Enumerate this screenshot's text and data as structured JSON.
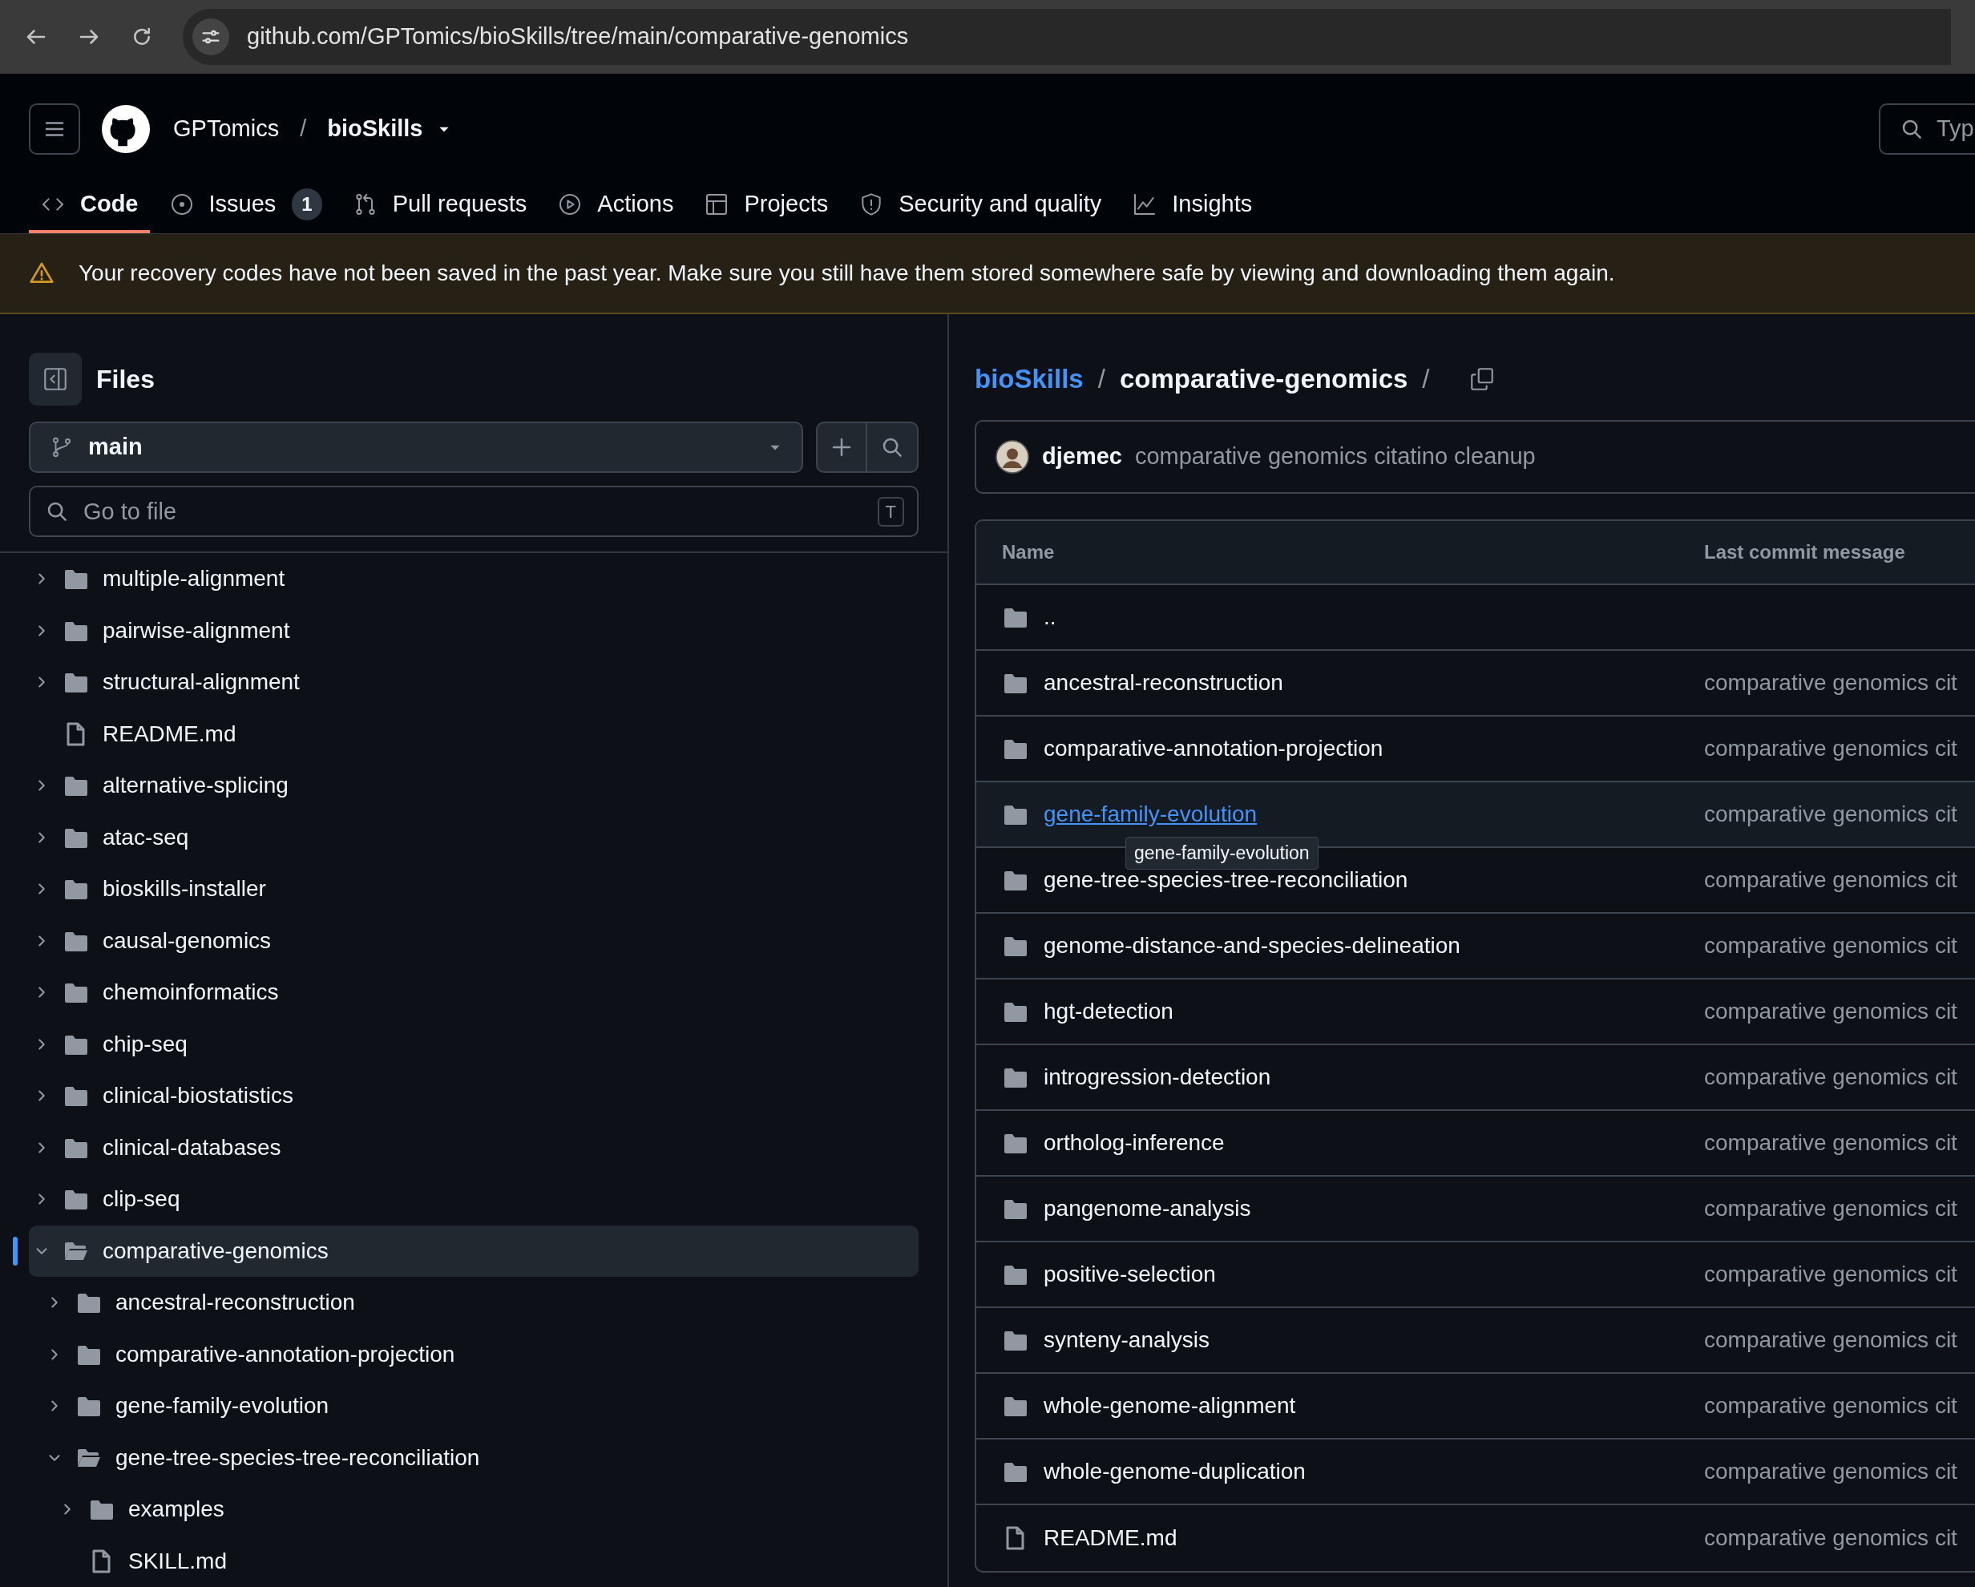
{
  "browser": {
    "url": "github.com/GPTomics/bioSkills/tree/main/comparative-genomics"
  },
  "header": {
    "owner": "GPTomics",
    "separator": "/",
    "repo": "bioSkills",
    "search_placeholder": "Typ"
  },
  "tabs": [
    {
      "kind": "code",
      "label": "Code",
      "selected": true
    },
    {
      "kind": "issues",
      "label": "Issues",
      "counter": "1",
      "selected": false
    },
    {
      "kind": "pulls",
      "label": "Pull requests",
      "selected": false
    },
    {
      "kind": "actions",
      "label": "Actions",
      "selected": false
    },
    {
      "kind": "projects",
      "label": "Projects",
      "selected": false
    },
    {
      "kind": "security",
      "label": "Security and quality",
      "selected": false
    },
    {
      "kind": "insights",
      "label": "Insights",
      "selected": false
    }
  ],
  "banner": {
    "message": "Your recovery codes have not been saved in the past year. Make sure you still have them stored somewhere safe by viewing and downloading them again."
  },
  "sidebar": {
    "title": "Files",
    "branch": "main",
    "search_placeholder": "Go to file",
    "shortcut": "T",
    "tree": [
      {
        "children": [
          {
            "name": "multiple-alignment",
            "kind": "folder",
            "expanded": false,
            "selected": false
          },
          {
            "name": "pairwise-alignment",
            "kind": "folder",
            "expanded": false,
            "selected": false
          },
          {
            "name": "structural-alignment",
            "kind": "folder",
            "expanded": false,
            "selected": false
          },
          {
            "name": "README.md",
            "kind": "file",
            "selected": false
          }
        ]
      },
      {
        "name": "alternative-splicing",
        "kind": "folder",
        "expanded": false,
        "selected": false
      },
      {
        "name": "atac-seq",
        "kind": "folder",
        "expanded": false,
        "selected": false
      },
      {
        "name": "bioskills-installer",
        "kind": "folder",
        "expanded": false,
        "selected": false
      },
      {
        "name": "causal-genomics",
        "kind": "folder",
        "expanded": false,
        "selected": false
      },
      {
        "name": "chemoinformatics",
        "kind": "folder",
        "expanded": false,
        "selected": false
      },
      {
        "name": "chip-seq",
        "kind": "folder",
        "expanded": false,
        "selected": false
      },
      {
        "name": "clinical-biostatistics",
        "kind": "folder",
        "expanded": false,
        "selected": false
      },
      {
        "name": "clinical-databases",
        "kind": "folder",
        "expanded": false,
        "selected": false
      },
      {
        "name": "clip-seq",
        "kind": "folder",
        "expanded": false,
        "selected": false
      },
      {
        "name": "comparative-genomics",
        "kind": "folder",
        "expanded": true,
        "selected": true,
        "children": [
          {
            "name": "ancestral-reconstruction",
            "kind": "folder",
            "expanded": false,
            "selected": false
          },
          {
            "name": "comparative-annotation-projection",
            "kind": "folder",
            "expanded": false,
            "selected": false
          },
          {
            "name": "gene-family-evolution",
            "kind": "folder",
            "expanded": false,
            "selected": false
          },
          {
            "name": "gene-tree-species-tree-reconciliation",
            "kind": "folder",
            "expanded": true,
            "selected": false,
            "children": [
              {
                "name": "examples",
                "kind": "folder",
                "expanded": false,
                "selected": false
              },
              {
                "name": "SKILL.md",
                "kind": "file",
                "selected": false
              }
            ]
          }
        ]
      }
    ]
  },
  "breadcrumb": {
    "root": "bioSkills",
    "separator": "/",
    "current": "comparative-genomics",
    "trailing": "/"
  },
  "commit": {
    "author": "djemec",
    "message": "comparative genomics citatino cleanup"
  },
  "table": {
    "columns": [
      "Name",
      "Last commit message"
    ],
    "rows": [
      {
        "kind": "folder",
        "name": "..",
        "hovered": false
      },
      {
        "kind": "folder",
        "name": "ancestral-reconstruction",
        "message": "comparative genomics cit",
        "hovered": false
      },
      {
        "kind": "folder",
        "name": "comparative-annotation-projection",
        "message": "comparative genomics cit",
        "hovered": false
      },
      {
        "kind": "folder",
        "name": "gene-family-evolution",
        "message": "comparative genomics cit",
        "hovered": true,
        "tooltip": "gene-family-evolution"
      },
      {
        "kind": "folder",
        "name": "gene-tree-species-tree-reconciliation",
        "message": "comparative genomics cit",
        "hovered": false
      },
      {
        "kind": "folder",
        "name": "genome-distance-and-species-delineation",
        "message": "comparative genomics cit",
        "hovered": false
      },
      {
        "kind": "folder",
        "name": "hgt-detection",
        "message": "comparative genomics cit",
        "hovered": false
      },
      {
        "kind": "folder",
        "name": "introgression-detection",
        "message": "comparative genomics cit",
        "hovered": false
      },
      {
        "kind": "folder",
        "name": "ortholog-inference",
        "message": "comparative genomics cit",
        "hovered": false
      },
      {
        "kind": "folder",
        "name": "pangenome-analysis",
        "message": "comparative genomics cit",
        "hovered": false
      },
      {
        "kind": "folder",
        "name": "positive-selection",
        "message": "comparative genomics cit",
        "hovered": false
      },
      {
        "kind": "folder",
        "name": "synteny-analysis",
        "message": "comparative genomics cit",
        "hovered": false
      },
      {
        "kind": "folder",
        "name": "whole-genome-alignment",
        "message": "comparative genomics cit",
        "hovered": false
      },
      {
        "kind": "folder",
        "name": "whole-genome-duplication",
        "message": "comparative genomics cit",
        "hovered": false
      },
      {
        "kind": "file",
        "name": "README.md",
        "message": "comparative genomics cit",
        "hovered": false
      }
    ]
  }
}
